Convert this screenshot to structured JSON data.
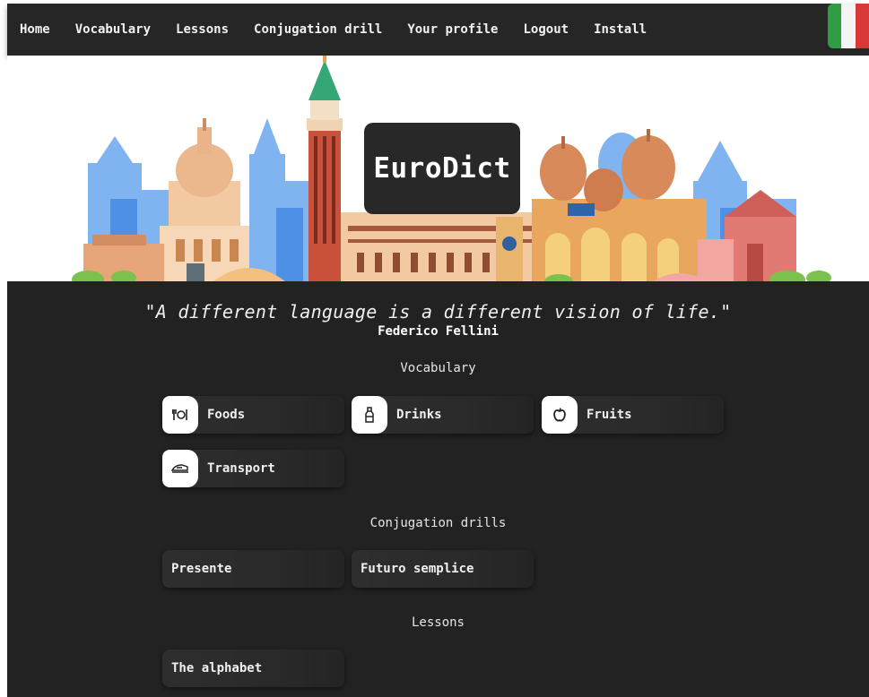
{
  "nav": {
    "items": [
      "Home",
      "Vocabulary",
      "Lessons",
      "Conjugation drill",
      "Your profile",
      "Logout",
      "Install"
    ]
  },
  "flag": {
    "colors": [
      "#2e9d43",
      "#ffffff",
      "#d93838"
    ],
    "icon": "italian-flag-icon"
  },
  "hero": {
    "title": "EuroDict"
  },
  "quote": {
    "text": "\"A different language is a different vision of life.\"",
    "author": "Federico Fellini"
  },
  "sections": {
    "vocabulary": {
      "title": "Vocabulary",
      "items": [
        {
          "label": "Foods",
          "icon": "utensils-icon"
        },
        {
          "label": "Drinks",
          "icon": "bottle-icon"
        },
        {
          "label": "Fruits",
          "icon": "apple-icon"
        },
        {
          "label": "Transport",
          "icon": "train-icon"
        }
      ]
    },
    "conjugation": {
      "title": "Conjugation drills",
      "items": [
        {
          "label": "Presente"
        },
        {
          "label": "Futuro semplice"
        }
      ]
    },
    "lessons": {
      "title": "Lessons",
      "items": [
        {
          "label": "The alphabet"
        }
      ]
    }
  },
  "colors": {
    "nav_bg": "#262626",
    "main_bg": "#222222",
    "card_bg": "#2b2b2b"
  }
}
